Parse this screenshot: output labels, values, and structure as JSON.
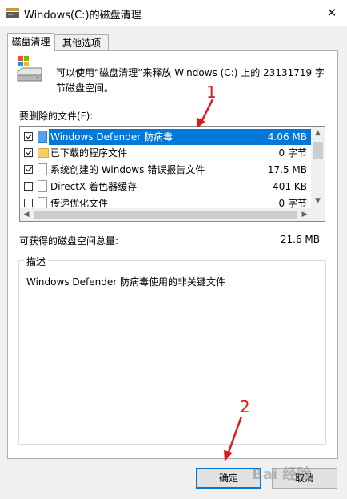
{
  "window": {
    "title": "Windows(C:)的磁盘清理",
    "close_glyph": "✕"
  },
  "tabs": [
    {
      "label": "磁盘清理",
      "active": true
    },
    {
      "label": "其他选项",
      "active": false
    }
  ],
  "intro": "可以使用“磁盘清理”来释放 Windows (C:) 上的 23131719 字节磁盘空间。",
  "files_label": "要删除的文件(F):",
  "files": [
    {
      "name": "Windows Defender 防病毒",
      "size": "4.06 MB",
      "checked": true,
      "icon": "shield-icon",
      "selected": true
    },
    {
      "name": "已下载的程序文件",
      "size": "0 字节",
      "checked": true,
      "icon": "folder-icon",
      "selected": false
    },
    {
      "name": "系统创建的 Windows 错误报告文件",
      "size": "17.5 MB",
      "checked": true,
      "icon": "document-icon",
      "selected": false
    },
    {
      "name": "DirectX 着色器缓存",
      "size": "401 KB",
      "checked": false,
      "icon": "document-icon",
      "selected": false
    },
    {
      "name": "传递优化文件",
      "size": "0 字节",
      "checked": false,
      "icon": "document-icon",
      "selected": false
    }
  ],
  "total": {
    "label": "可获得的磁盘空间总量:",
    "value": "21.6 MB"
  },
  "description": {
    "legend": "描述",
    "text": "Windows Defender 防病毒使用的非关键文件"
  },
  "buttons": {
    "ok": "确定",
    "cancel": "取消"
  },
  "annotations": {
    "marker_1": "1",
    "marker_2": "2",
    "color": "#e0181a"
  },
  "watermark": "Bai 经验",
  "colors": {
    "selection": "#0078d7",
    "window_bg": "#f0f0f0"
  }
}
